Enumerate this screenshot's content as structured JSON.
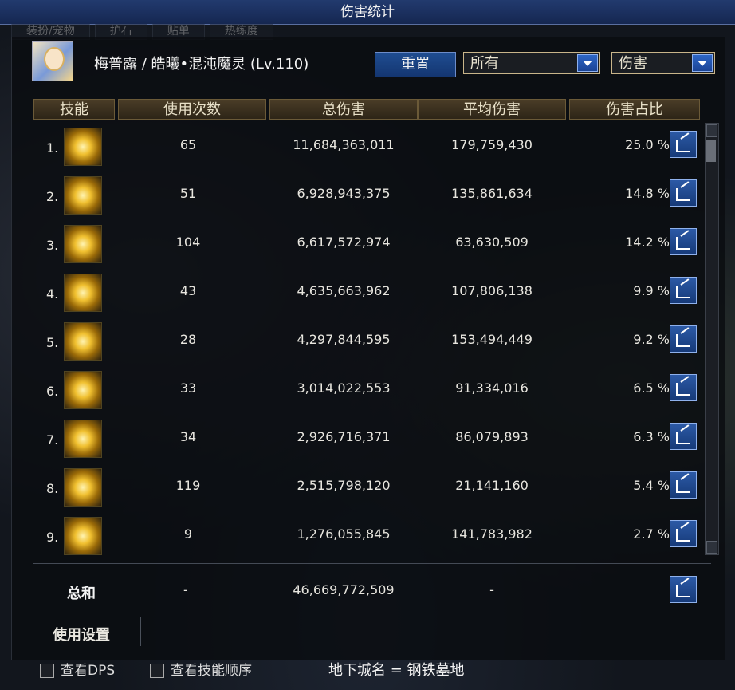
{
  "window": {
    "title": "伤害统计"
  },
  "bg_tabs": [
    "装扮/宠物",
    "护石",
    "贴单",
    "热练度"
  ],
  "character": {
    "name": "梅普露 / 皓曦•混沌魔灵 (Lv.110)"
  },
  "controls": {
    "reset_label": "重置",
    "filter_selected": "所有",
    "mode_selected": "伤害"
  },
  "columns": {
    "skill": "技能",
    "uses": "使用次数",
    "total": "总伤害",
    "avg": "平均伤害",
    "pct": "伤害占比"
  },
  "rows": [
    {
      "index": "1.",
      "uses": "65",
      "total": "11,684,363,011",
      "avg": "179,759,430",
      "pct": "25.0 %"
    },
    {
      "index": "2.",
      "uses": "51",
      "total": "6,928,943,375",
      "avg": "135,861,634",
      "pct": "14.8 %"
    },
    {
      "index": "3.",
      "uses": "104",
      "total": "6,617,572,974",
      "avg": "63,630,509",
      "pct": "14.2 %"
    },
    {
      "index": "4.",
      "uses": "43",
      "total": "4,635,663,962",
      "avg": "107,806,138",
      "pct": "9.9 %"
    },
    {
      "index": "5.",
      "uses": "28",
      "total": "4,297,844,595",
      "avg": "153,494,449",
      "pct": "9.2 %"
    },
    {
      "index": "6.",
      "uses": "33",
      "total": "3,014,022,553",
      "avg": "91,334,016",
      "pct": "6.5 %"
    },
    {
      "index": "7.",
      "uses": "34",
      "total": "2,926,716,371",
      "avg": "86,079,893",
      "pct": "6.3 %"
    },
    {
      "index": "8.",
      "uses": "119",
      "total": "2,515,798,120",
      "avg": "21,141,160",
      "pct": "5.4 %"
    },
    {
      "index": "9.",
      "uses": "9",
      "total": "1,276,055,845",
      "avg": "141,783,982",
      "pct": "2.7 %"
    }
  ],
  "totals": {
    "label": "总和",
    "uses": "-",
    "total": "46,669,772,509",
    "avg": "-"
  },
  "settings": {
    "label": "使用设置"
  },
  "footer": {
    "dps_label": "查看DPS",
    "order_label": "查看技能顺序",
    "dungeon": "地下城名 = 钢铁墓地"
  },
  "icons": {
    "share": "share-icon",
    "dropdown": "chevron-down-icon"
  },
  "colors": {
    "title_bar": "#1c336a",
    "button_blue": "#1f4d91",
    "header_gold": "#4a3d27"
  }
}
